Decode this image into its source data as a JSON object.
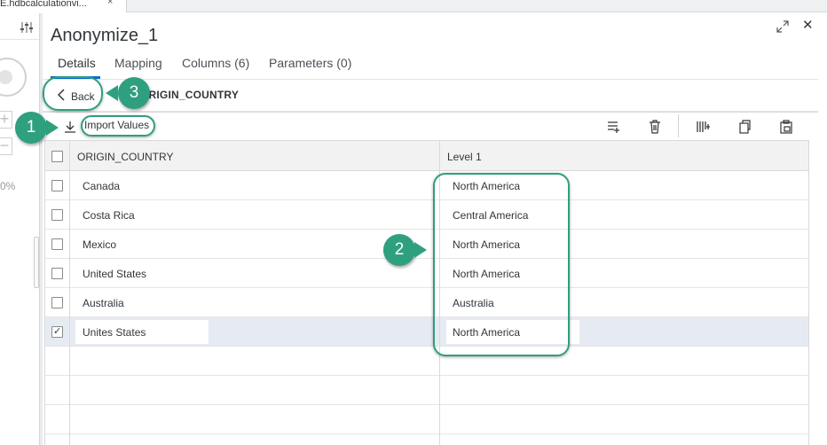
{
  "editor_tab": {
    "title": "E.hdbcalculationvi...",
    "close": "×"
  },
  "canvas": {
    "zoom_text": "0%",
    "zoom_in": "+",
    "zoom_out": "−"
  },
  "panel": {
    "title": "Anonymize_1",
    "tabs": [
      {
        "label": "Details",
        "active": true
      },
      {
        "label": "Mapping"
      },
      {
        "label": "Columns (6)"
      },
      {
        "label": "Parameters (0)"
      }
    ],
    "back_label": "Back",
    "column_title": "ORIGIN_COUNTRY",
    "import_label": "Import Values",
    "close": "✕"
  },
  "table": {
    "headers": [
      "ORIGIN_COUNTRY",
      "Level 1"
    ],
    "rows": [
      {
        "origin": "Canada",
        "level1": "North America",
        "checked": false
      },
      {
        "origin": "Costa Rica",
        "level1": "Central America",
        "checked": false
      },
      {
        "origin": "Mexico",
        "level1": "North America",
        "checked": false
      },
      {
        "origin": "United States",
        "level1": "North America",
        "checked": false
      },
      {
        "origin": "Australia",
        "level1": "Australia",
        "checked": false
      },
      {
        "origin": "Unites States",
        "level1": "North America",
        "checked": true
      }
    ]
  },
  "callouts": {
    "one": "1",
    "two": "2",
    "three": "3"
  },
  "colors": {
    "callout": "#2e9f7f",
    "accent": "#0a6ed1",
    "selected_row": "#e6ebf3"
  }
}
